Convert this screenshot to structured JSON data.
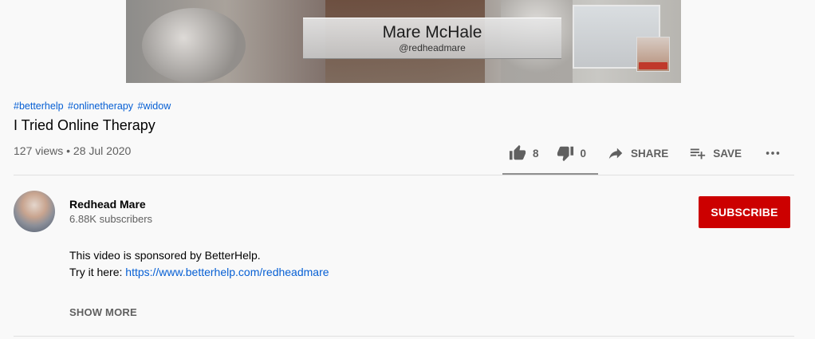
{
  "player": {
    "overlay_name": "Mare McHale",
    "overlay_handle": "@redheadmare"
  },
  "hashtags": [
    "#betterhelp",
    "#onlinetherapy",
    "#widow"
  ],
  "video": {
    "title": "I Tried Online Therapy",
    "meta": "127 views • 28 Jul 2020"
  },
  "actions": {
    "like_count": "8",
    "dislike_count": "0",
    "share_label": "SHARE",
    "save_label": "SAVE",
    "like_ratio": 1.0
  },
  "channel": {
    "name": "Redhead Mare",
    "subscribers": "6.88K subscribers",
    "subscribe_label": "SUBSCRIBE"
  },
  "description": {
    "line1": "This video is sponsored by BetterHelp.",
    "line2_prefix": "Try it here: ",
    "link": "https://www.betterhelp.com/redheadmare",
    "show_more": "SHOW MORE"
  },
  "colors": {
    "subscribe_bg": "#cc0000",
    "link": "#065fd4",
    "muted_text": "#606060"
  },
  "icons": [
    "thumb-up-icon",
    "thumb-down-icon",
    "share-arrow-icon",
    "playlist-add-icon",
    "more-horiz-icon"
  ]
}
